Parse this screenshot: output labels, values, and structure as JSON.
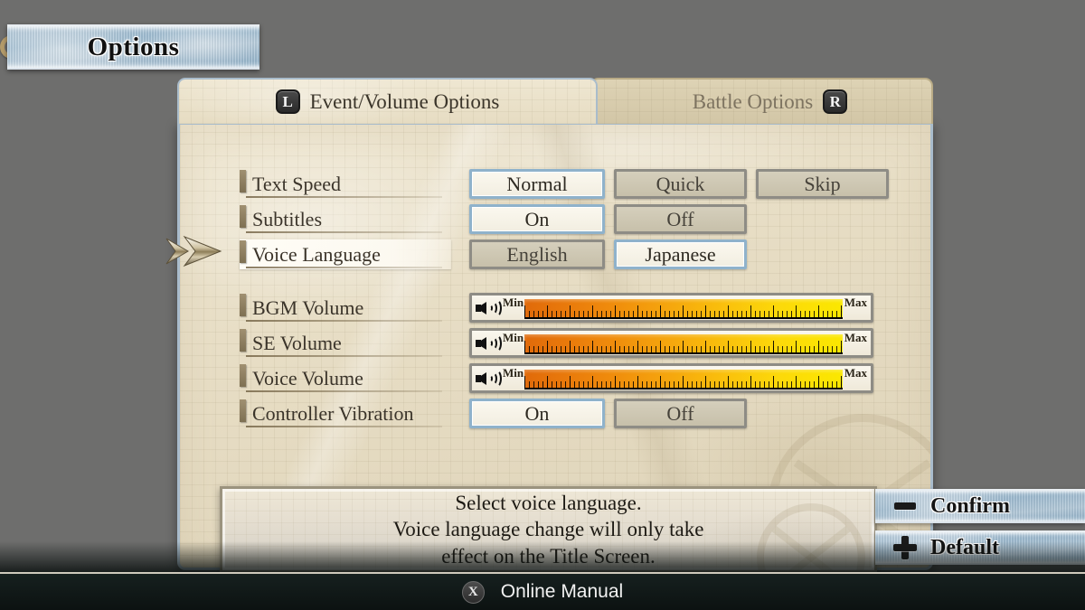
{
  "banner": {
    "title": "Options"
  },
  "tabs": [
    {
      "label": "Event/Volume Options",
      "key": "L",
      "active": true
    },
    {
      "label": "Battle Options",
      "key": "R",
      "active": false
    }
  ],
  "settings": [
    {
      "label": "Text Speed",
      "type": "options",
      "highlighted": false,
      "options": [
        {
          "label": "Normal",
          "selected": true
        },
        {
          "label": "Quick",
          "selected": false
        },
        {
          "label": "Skip",
          "selected": false
        }
      ]
    },
    {
      "label": "Subtitles",
      "type": "options",
      "highlighted": false,
      "options": [
        {
          "label": "On",
          "selected": true
        },
        {
          "label": "Off",
          "selected": false
        }
      ]
    },
    {
      "label": "Voice Language",
      "type": "options",
      "highlighted": true,
      "options": [
        {
          "label": "English",
          "selected": false
        },
        {
          "label": "Japanese",
          "selected": true
        }
      ]
    },
    {
      "label": "BGM Volume",
      "type": "slider",
      "highlighted": false,
      "min_label": "Min",
      "max_label": "Max",
      "value_percent": 100
    },
    {
      "label": "SE Volume",
      "type": "slider",
      "highlighted": false,
      "min_label": "Min",
      "max_label": "Max",
      "value_percent": 100
    },
    {
      "label": "Voice Volume",
      "type": "slider",
      "highlighted": false,
      "min_label": "Min",
      "max_label": "Max",
      "value_percent": 100
    },
    {
      "label": "Controller Vibration",
      "type": "options",
      "highlighted": false,
      "options": [
        {
          "label": "On",
          "selected": true
        },
        {
          "label": "Off",
          "selected": false
        }
      ]
    }
  ],
  "description": {
    "line1": "Select voice language.",
    "line2": "Voice language change will only take",
    "line3": "effect on the Title Screen."
  },
  "actions": [
    {
      "label": "Confirm",
      "key": "minus-button-icon"
    },
    {
      "label": "Default",
      "key": "plus-button-icon"
    }
  ],
  "bottom_bar": {
    "key": "X",
    "label": "Online Manual"
  },
  "colors": {
    "background": "#6e6e6d",
    "paper": "#e6dcc3",
    "banner_blue": "#9ebbd0",
    "selected_border": "#8fb2cb",
    "selected_fill": "#fbf8ef",
    "unselected_fill": "#cfc8b4",
    "unselected_border": "#8e8c85",
    "slider_min": "#e06a0a",
    "slider_max": "#fbe800",
    "text_dark": "#3b342a"
  }
}
